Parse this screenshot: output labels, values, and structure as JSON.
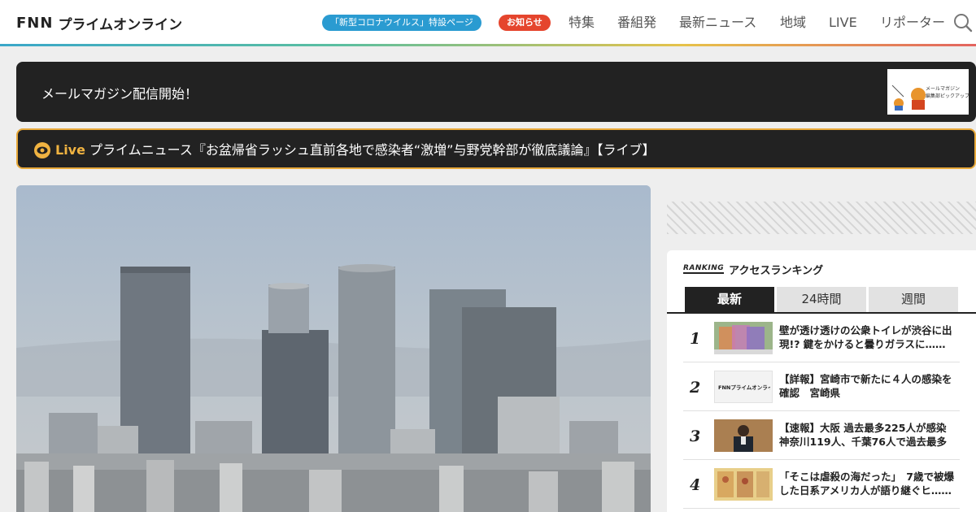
{
  "header": {
    "logo_mark": "FNN",
    "logo_text": "プライムオンライン",
    "covid_badge": "「新型コロナウイルス」特設ページ",
    "notice_badge": "お知らせ",
    "nav": [
      "特集",
      "番組発",
      "最新ニュース",
      "地域",
      "LIVE",
      "リポーター"
    ],
    "search_icon": "search-icon"
  },
  "mail_banner": {
    "text": "メールマガジン配信開始！",
    "thumb_line1": "メールマガジン",
    "thumb_line2": "編集部ピックアップ"
  },
  "live": {
    "label": "Live",
    "title": "プライムニュース『お盆帰省ラッシュ直前各地で感染者“激増”与野党幹部が徹底議論』【ライブ】"
  },
  "ranking": {
    "badge": "RANKING",
    "title": "アクセスランキング",
    "tabs": [
      "最新",
      "24時間",
      "週間"
    ],
    "active_tab": "最新",
    "items": [
      {
        "rank": "1",
        "text": "壁が透け透けの公衆トイレが渋谷に出現!? 鍵をかけると曇りガラスに……"
      },
      {
        "rank": "2",
        "text": "【詳報】宮崎市で新たに４人の感染を確認　宮崎県",
        "thumb_text": "FNNプライムオンライン"
      },
      {
        "rank": "3",
        "text": "【速報】大阪 過去最多225人が感染 神奈川119人、千葉76人で過去最多"
      },
      {
        "rank": "4",
        "text": "「そこは虐殺の海だった」　7歳で被爆した日系アメリカ人が語り継ぐヒ……"
      }
    ]
  },
  "colors": {
    "accent_live": "#f0b341",
    "covid_badge": "#2a9bd1",
    "notice_badge": "#e5452d"
  }
}
